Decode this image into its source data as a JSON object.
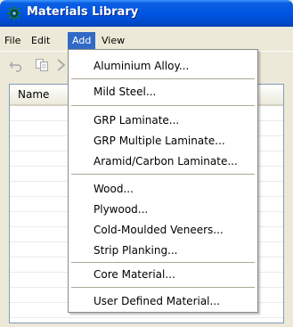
{
  "window": {
    "title": "Materials Library"
  },
  "menubar": {
    "items": [
      "File",
      "Edit",
      "Add",
      "View"
    ],
    "active": "Add"
  },
  "listview": {
    "columns": [
      "Name"
    ]
  },
  "add_menu": {
    "groups": [
      [
        "Aluminium Alloy..."
      ],
      [
        "Mild Steel..."
      ],
      [
        "GRP Laminate...",
        "GRP Multiple Laminate...",
        "Aramid/Carbon Laminate..."
      ],
      [
        "Wood...",
        "Plywood...",
        "Cold-Moulded Veneers...",
        "Strip Planking..."
      ],
      [
        "Core Material..."
      ],
      [
        "User Defined Material..."
      ]
    ]
  },
  "icons": {
    "title": "materials-app-icon",
    "toolbar": [
      "undo-icon",
      "copy-icon",
      "arrow-icon"
    ]
  },
  "colors": {
    "accent": "#316ac5",
    "titlebar": "#0055e5"
  }
}
